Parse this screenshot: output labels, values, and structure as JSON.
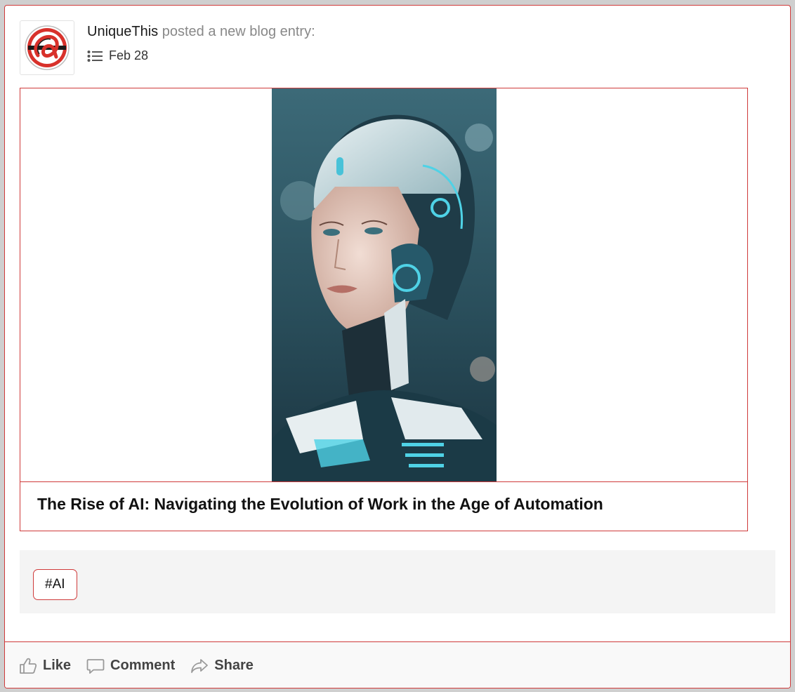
{
  "post": {
    "author": "UniqueThis",
    "action_text": " posted a new blog entry:",
    "date": "Feb 28"
  },
  "entry": {
    "title": "The Rise of AI: Navigating the Evolution of Work in the Age of Automation",
    "image_icon": "ai-robot-woman-image"
  },
  "tags": [
    "#AI"
  ],
  "actions": {
    "like": "Like",
    "comment": "Comment",
    "share": "Share"
  },
  "colors": {
    "accent": "#cf3a3a",
    "background": "#cfcfcf",
    "tag_area": "#f4f4f4"
  },
  "icons": {
    "avatar": "unique-this-logo",
    "meta": "list-icon",
    "like": "thumbs-up-icon",
    "comment": "comment-bubble-icon",
    "share": "share-arrow-icon"
  }
}
